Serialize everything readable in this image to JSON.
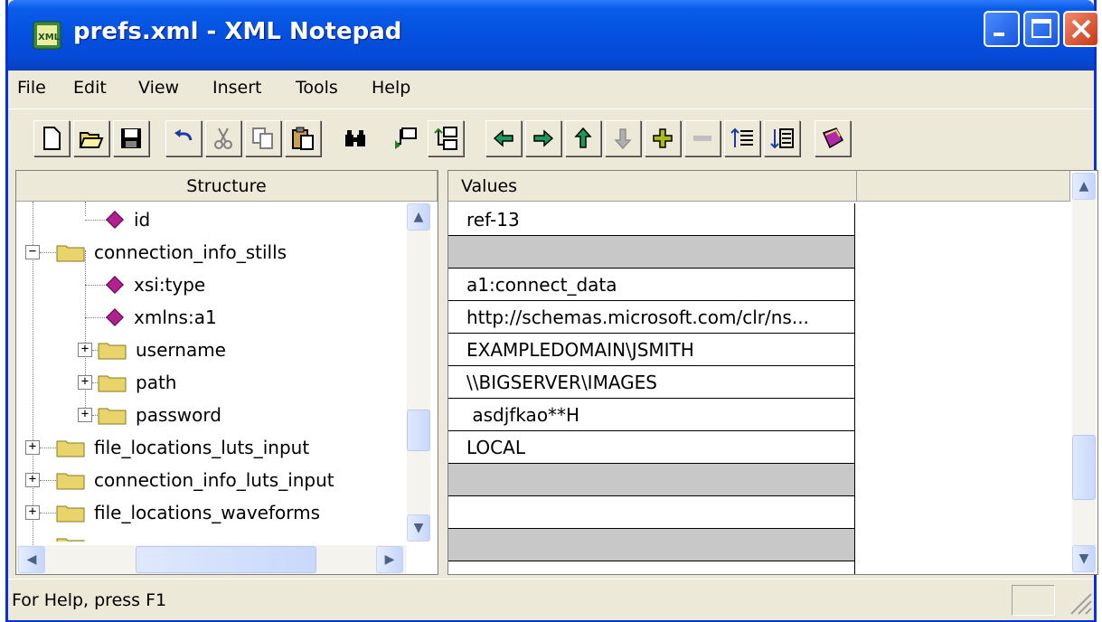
{
  "window": {
    "title": "prefs.xml - XML Notepad",
    "app_icon": "xml-notepad-icon"
  },
  "menu": [
    {
      "label": "File"
    },
    {
      "label": "Edit"
    },
    {
      "label": "View"
    },
    {
      "label": "Insert"
    },
    {
      "label": "Tools"
    },
    {
      "label": "Help"
    }
  ],
  "toolbar": {
    "buttons": [
      "new-file-icon",
      "open-folder-icon",
      "save-icon",
      "undo-icon",
      "cut-icon",
      "copy-icon",
      "paste-icon",
      "find-icon",
      "insert-element-icon",
      "insert-child-icon",
      "move-left-icon",
      "move-right-icon",
      "move-up-icon",
      "move-down-icon",
      "add-icon",
      "remove-icon",
      "expand-all-icon",
      "collapse-all-icon",
      "help-book-icon"
    ]
  },
  "structure": {
    "header": "Structure",
    "items": [
      {
        "label": "id",
        "type": "attribute"
      },
      {
        "label": "connection_info_stills",
        "type": "element",
        "expanded": true
      },
      {
        "label": "xsi:type",
        "type": "attribute"
      },
      {
        "label": "xmlns:a1",
        "type": "attribute"
      },
      {
        "label": "username",
        "type": "element",
        "expanded": false
      },
      {
        "label": "path",
        "type": "element",
        "expanded": false
      },
      {
        "label": "password",
        "type": "element",
        "expanded": false
      },
      {
        "label": "file_locations_luts_input",
        "type": "element",
        "expanded": false
      },
      {
        "label": "connection_info_luts_input",
        "type": "element",
        "expanded": false
      },
      {
        "label": "file_locations_waveforms",
        "type": "element",
        "expanded": false
      }
    ]
  },
  "values": {
    "header": "Values",
    "rows": [
      {
        "text": "ref-13",
        "shaded": false
      },
      {
        "text": "",
        "shaded": true
      },
      {
        "text": "a1:connect_data",
        "shaded": false
      },
      {
        "text": "http://schemas.microsoft.com/clr/ns...",
        "shaded": false
      },
      {
        "text": "EXAMPLEDOMAIN\\JSMITH",
        "shaded": false
      },
      {
        "text": "\\\\BIGSERVER\\IMAGES",
        "shaded": false
      },
      {
        "text": " asdjfkao**H",
        "shaded": false
      },
      {
        "text": "LOCAL",
        "shaded": false
      },
      {
        "text": "",
        "shaded": true
      },
      {
        "text": "",
        "shaded": false
      },
      {
        "text": "",
        "shaded": true
      }
    ]
  },
  "status": {
    "text": "For Help, press F1"
  },
  "colors": {
    "titlebar": "#0550e0",
    "chrome": "#ece9d8",
    "attribute_icon": "#b0208e",
    "folder_icon": "#e8d46a",
    "shaded_row": "#c8c8c8"
  }
}
